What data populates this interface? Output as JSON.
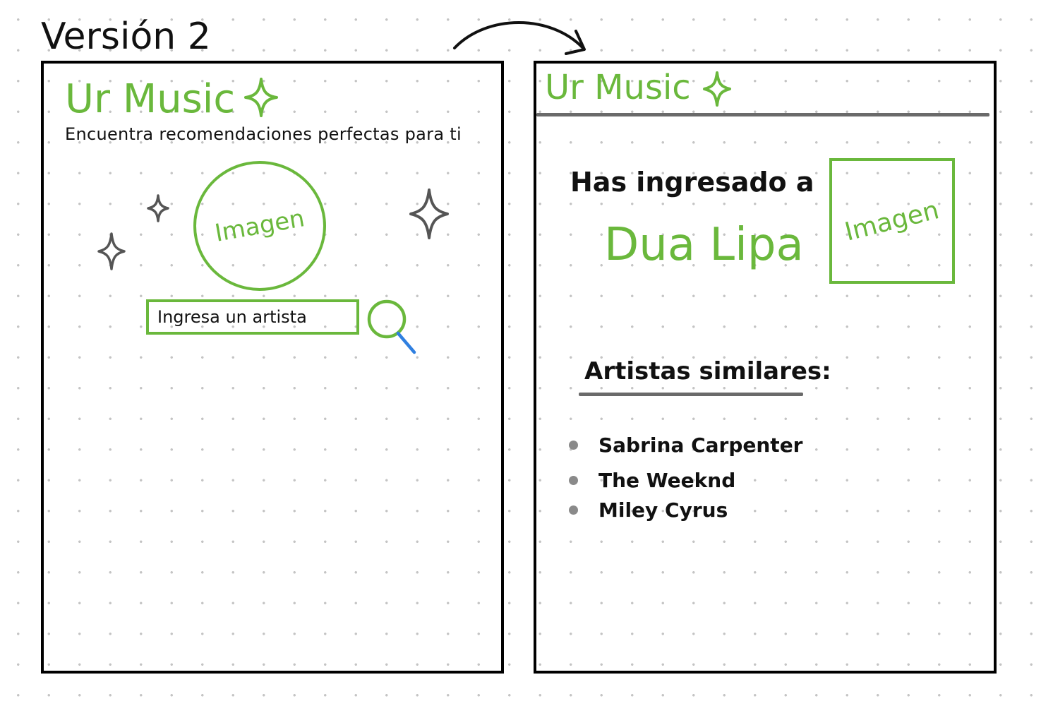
{
  "version_label": "Versión 2",
  "colors": {
    "accent": "#6ab83c",
    "ink": "#111111",
    "sparkle": "#555555",
    "search_handle": "#2f7fe0",
    "rule": "#6a6a6a",
    "bullet": "#8a8a8a"
  },
  "screen_search": {
    "brand": "Ur Music",
    "tagline": "Encuentra recomendaciones perfectas para ti",
    "image_placeholder": "Imagen",
    "search_placeholder": "Ingresa un artista",
    "icons": [
      "sparkle-icon",
      "sparkle-icon",
      "sparkle-icon",
      "sparkle-icon",
      "search-icon"
    ]
  },
  "screen_result": {
    "brand": "Ur Music",
    "heading": "Has ingresado a",
    "artist": "Dua Lipa",
    "image_placeholder": "Imagen",
    "similar_title": "Artistas similares:",
    "similar_artists": [
      "Sabrina Carpenter",
      "The Weeknd",
      "Miley Cyrus"
    ]
  }
}
